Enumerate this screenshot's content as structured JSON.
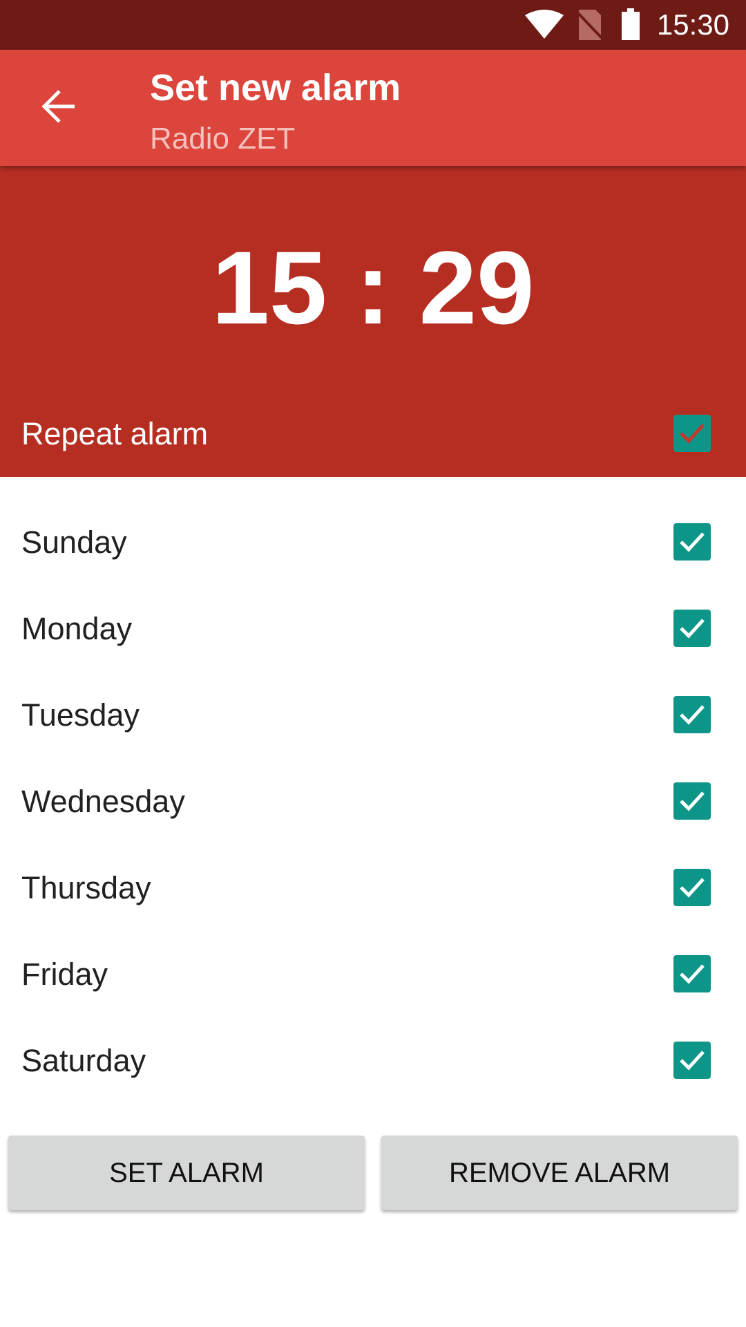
{
  "status_bar": {
    "time": "15:30",
    "icons": [
      "wifi-icon",
      "no-sim-icon",
      "battery-icon"
    ]
  },
  "toolbar": {
    "title": "Set new alarm",
    "subtitle": "Radio ZET",
    "back_icon": "arrow-back-icon"
  },
  "alarm": {
    "time": "15 : 29",
    "repeat_label": "Repeat alarm",
    "repeat_checked": true
  },
  "days": [
    {
      "label": "Sunday",
      "checked": true
    },
    {
      "label": "Monday",
      "checked": true
    },
    {
      "label": "Tuesday",
      "checked": true
    },
    {
      "label": "Wednesday",
      "checked": true
    },
    {
      "label": "Thursday",
      "checked": true
    },
    {
      "label": "Friday",
      "checked": true
    },
    {
      "label": "Saturday",
      "checked": true
    }
  ],
  "buttons": {
    "set": "SET ALARM",
    "remove": "REMOVE ALARM"
  },
  "colors": {
    "status_bar": "#6f1b15",
    "toolbar": "#db453b",
    "hero": "#b62e22",
    "checkbox": "#0d9688"
  }
}
